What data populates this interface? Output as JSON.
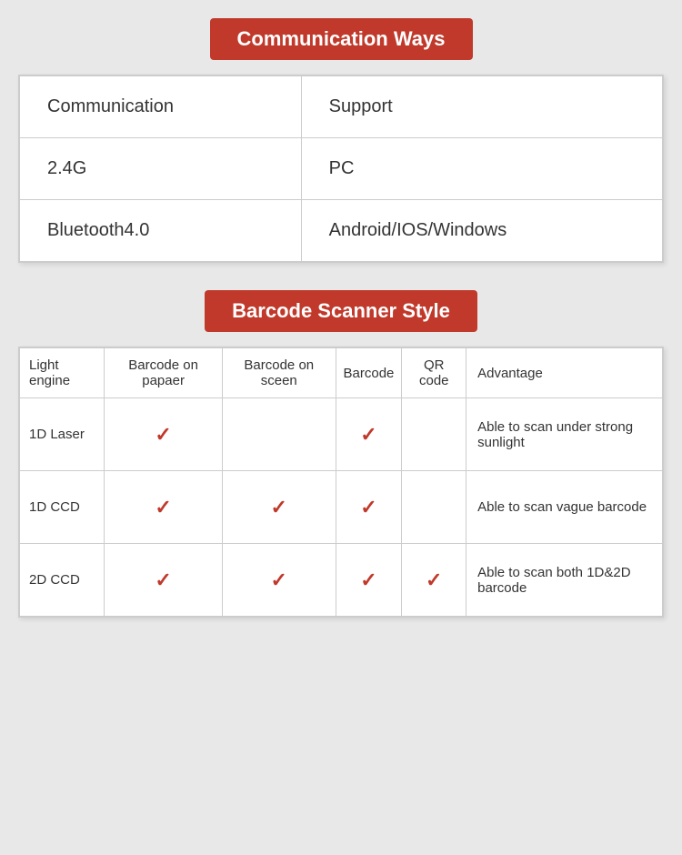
{
  "section1": {
    "title": "Communication Ways",
    "table": {
      "headers": [
        "Communication",
        "Support"
      ],
      "rows": [
        [
          "2.4G",
          "PC"
        ],
        [
          "Bluetooth4.0",
          "Android/IOS/Windows"
        ]
      ]
    }
  },
  "section2": {
    "title": "Barcode Scanner Style",
    "table": {
      "headers": [
        "Light engine",
        "Barcode on papaer",
        "Barcode on sceen",
        "Barcode",
        "QR code",
        "Advantage"
      ],
      "rows": [
        {
          "engine": "1D Laser",
          "barcode_paper": true,
          "barcode_screen": false,
          "barcode": true,
          "qr_code": false,
          "advantage": "Able to scan under strong sunlight"
        },
        {
          "engine": "1D CCD",
          "barcode_paper": true,
          "barcode_screen": true,
          "barcode": true,
          "qr_code": false,
          "advantage": "Able to scan vague barcode"
        },
        {
          "engine": "2D CCD",
          "barcode_paper": true,
          "barcode_screen": true,
          "barcode": true,
          "qr_code": true,
          "advantage": "Able to scan both 1D&2D barcode"
        }
      ]
    }
  },
  "check_symbol": "✓"
}
